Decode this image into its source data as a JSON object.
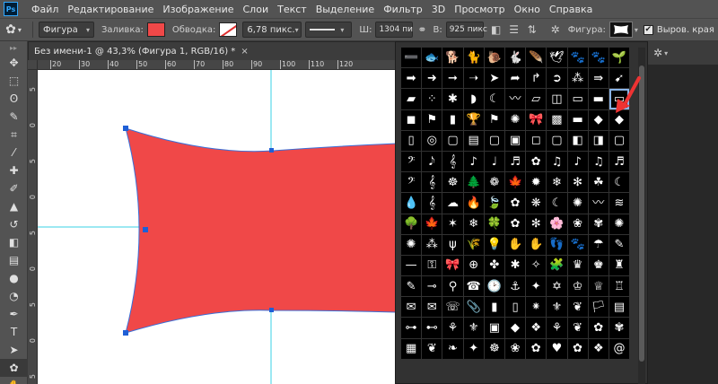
{
  "app": {
    "logo": "Ps"
  },
  "menu": [
    "Файл",
    "Редактирование",
    "Изображение",
    "Слои",
    "Текст",
    "Выделение",
    "Фильтр",
    "3D",
    "Просмотр",
    "Окно",
    "Справка"
  ],
  "options_bar": {
    "tool_mode": "Фигура",
    "fill_label": "Заливка:",
    "fill_color": "#f04848",
    "stroke_label": "Обводка:",
    "stroke_width": "6,78 пикс.",
    "width_label": "Ш:",
    "width_value": "1304 пи",
    "link_icon": "link-icon",
    "height_label": "В:",
    "height_value": "925 пикс",
    "shape_label": "Фигура:",
    "align_edges_label": "Выров. края",
    "align_edges_checked": true
  },
  "document": {
    "tab_title": "Без имени-1 @ 43,3% (Фигура 1, RGB/16) *",
    "close_label": "×",
    "ruler_top_labels": [
      "20",
      "30",
      "40",
      "50",
      "60",
      "70",
      "80",
      "90",
      "100",
      "110",
      "120"
    ],
    "ruler_left_labels": [
      "5",
      "0",
      "5",
      "0",
      "5",
      "0",
      "5",
      "0",
      "5"
    ],
    "shape_fill": "#f04848"
  },
  "tools": [
    {
      "name": "move-tool",
      "glyph": "✥"
    },
    {
      "name": "marquee-tool",
      "glyph": "⬚"
    },
    {
      "name": "lasso-tool",
      "glyph": "ʘ"
    },
    {
      "name": "quick-select-tool",
      "glyph": "✎"
    },
    {
      "name": "crop-tool",
      "glyph": "⌗"
    },
    {
      "name": "eyedropper-tool",
      "glyph": "⁄"
    },
    {
      "name": "healing-tool",
      "glyph": "✚"
    },
    {
      "name": "brush-tool",
      "glyph": "✐"
    },
    {
      "name": "stamp-tool",
      "glyph": "▲"
    },
    {
      "name": "history-brush-tool",
      "glyph": "↺"
    },
    {
      "name": "eraser-tool",
      "glyph": "◧"
    },
    {
      "name": "gradient-tool",
      "glyph": "▤"
    },
    {
      "name": "blur-tool",
      "glyph": "●"
    },
    {
      "name": "dodge-tool",
      "glyph": "◔"
    },
    {
      "name": "pen-tool",
      "glyph": "✒"
    },
    {
      "name": "type-tool",
      "glyph": "T"
    },
    {
      "name": "path-select-tool",
      "glyph": "➤"
    },
    {
      "name": "custom-shape-tool",
      "glyph": "✿"
    },
    {
      "name": "hand-tool",
      "glyph": "✋"
    }
  ],
  "shapes": [
    "➖",
    "🐟",
    "🐕",
    "🐈",
    "🐌",
    "🐇",
    "🪶",
    "🕊",
    "🐾",
    "🐾",
    "🌱",
    "➡",
    "➜",
    "➞",
    "➝",
    "➤",
    "➦",
    "↱",
    "➲",
    "⁂",
    "⇛",
    "➹",
    "▰",
    "⁘",
    "✱",
    "◗",
    "☾",
    "〰",
    "▱",
    "◫",
    "▭",
    "▬",
    "▭",
    "◼",
    "⚑",
    "▮",
    "🏆",
    "⚑",
    "✺",
    "🎀",
    "▩",
    "▬",
    "◆",
    "◆",
    "▯",
    "◎",
    "▢",
    "▤",
    "▢",
    "▣",
    "◻",
    "▢",
    "◧",
    "◨",
    "▢",
    "𝄢",
    "𝅘𝅥𝅮",
    "𝄞",
    "♪",
    "♩",
    "♬",
    "✿",
    "♫",
    "♪",
    "♫",
    "♬",
    "𝄢",
    "𝄞",
    "☸",
    "🌲",
    "❁",
    "🍁",
    "✹",
    "❄",
    "✻",
    "☘",
    "☾",
    "💧",
    "𝄞",
    "☁",
    "🔥",
    "🍃",
    "✿",
    "❋",
    "☾",
    "✺",
    "〰",
    "≋",
    "🌳",
    "🍁",
    "✶",
    "❄",
    "🍀",
    "✿",
    "✻",
    "🌸",
    "❀",
    "✾",
    "✺",
    "✺",
    "⁂",
    "ψ",
    "🌾",
    "💡",
    "✋",
    "✋",
    "👣",
    "🐾",
    "☂",
    "✎",
    "—",
    "⚿",
    "🎀",
    "⊕",
    "✤",
    "✱",
    "✧",
    "🧩",
    "♛",
    "♚",
    "♜",
    "✎",
    "⊸",
    "⚲",
    "☎",
    "🕑",
    "⚓",
    "✦",
    "✡",
    "♔",
    "♕",
    "♖",
    "✉",
    "✉",
    "☏",
    "📎",
    "▮",
    "▯",
    "⁕",
    "⚜",
    "❦",
    "🏳",
    "▤",
    "⊶",
    "⊷",
    "⚘",
    "⚜",
    "▣",
    "◆",
    "❖",
    "⚘",
    "❦",
    "✿",
    "✾",
    "▦",
    "❦",
    "❧",
    "✦",
    "☸",
    "❀",
    "✿",
    "♥",
    "✿",
    "❖",
    "@"
  ],
  "selected_shape_index": 32,
  "dock": {
    "gear_icon": "gear-icon"
  }
}
